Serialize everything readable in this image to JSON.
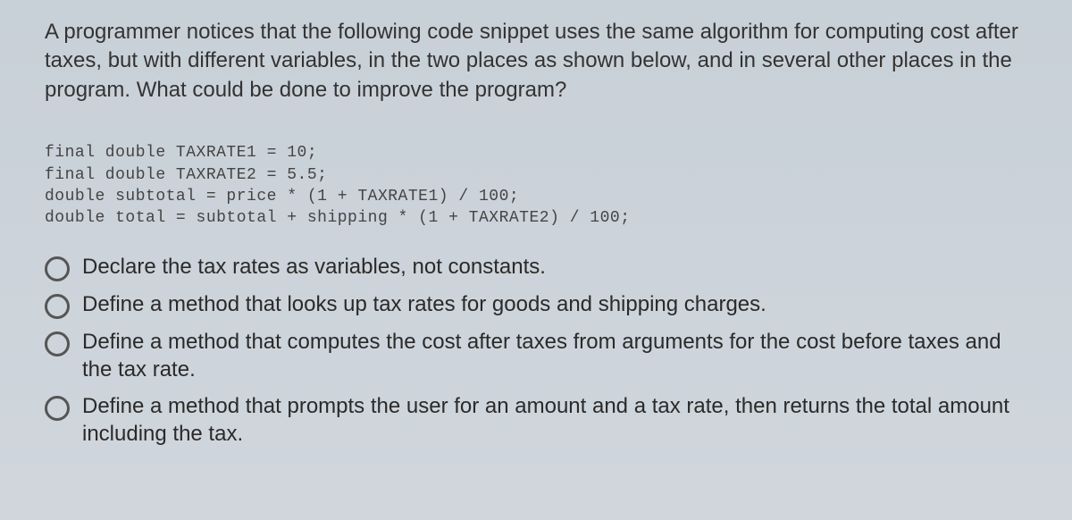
{
  "question": "A programmer notices that the following code snippet uses the same algorithm for computing cost after taxes, but with different variables, in the two places as shown below, and in several other places in the program. What could be done to improve the program?",
  "code_lines": [
    "final double TAXRATE1 = 10;",
    "final double TAXRATE2 = 5.5;",
    "double subtotal = price * (1 + TAXRATE1) / 100;",
    "double total = subtotal + shipping * (1 + TAXRATE2) / 100;"
  ],
  "options": [
    "Declare the tax rates as variables, not constants.",
    "Define a method that looks up tax rates for goods and shipping charges.",
    "Define a method that computes the cost after taxes from arguments for the cost before taxes and the tax rate.",
    "Define a method that prompts the user for an amount and a tax rate, then returns the total amount including the tax."
  ]
}
